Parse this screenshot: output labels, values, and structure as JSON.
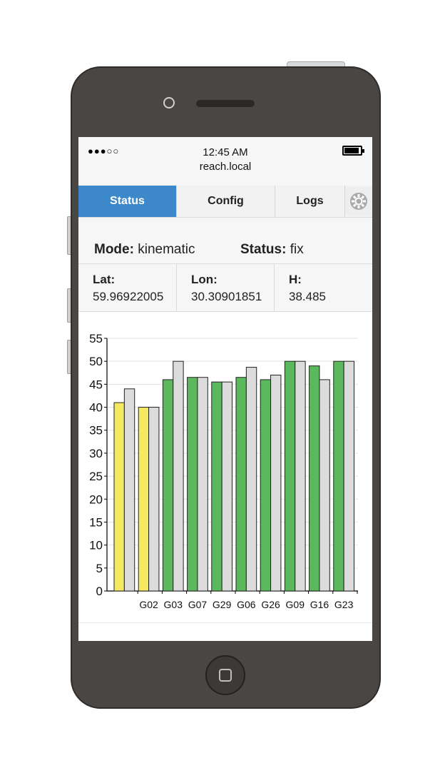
{
  "status_bar": {
    "signal_dots": "●●●○○",
    "time": "12:45 AM",
    "url": "reach.local"
  },
  "tabs": [
    {
      "label": "Status",
      "active": true
    },
    {
      "label": "Config",
      "active": false
    },
    {
      "label": "Logs",
      "active": false
    }
  ],
  "info": {
    "mode_label": "Mode:",
    "mode_value": "kinematic",
    "status_label": "Status:",
    "status_value": "fix",
    "lat_label": "Lat:",
    "lat_value": "59.96922005",
    "lon_label": "Lon:",
    "lon_value": "30.30901851",
    "h_label": "H:",
    "h_value": "38.485"
  },
  "colors": {
    "tab_active": "#3d88c9",
    "bar_green": "#5cb85c",
    "bar_yellow": "#f4e961",
    "bar_gray": "#dcdcdc"
  },
  "chart_data": {
    "type": "bar",
    "categories": [
      "",
      "G02",
      "G03",
      "G07",
      "G29",
      "G06",
      "G26",
      "G09",
      "G16",
      "G23"
    ],
    "series": [
      {
        "values": [
          41,
          40,
          46,
          46.5,
          45.5,
          46.5,
          46,
          50,
          49,
          50
        ],
        "colors": [
          "yellow",
          "yellow",
          "green",
          "green",
          "green",
          "green",
          "green",
          "green",
          "green",
          "green"
        ]
      },
      {
        "values": [
          44,
          40,
          50,
          46.5,
          45.5,
          48.7,
          47,
          50,
          46,
          50
        ],
        "colors": [
          "gray",
          "gray",
          "gray",
          "gray",
          "gray",
          "gray",
          "gray",
          "gray",
          "gray",
          "gray"
        ]
      }
    ],
    "ylim": [
      0,
      55
    ],
    "yticks": [
      0,
      5,
      10,
      15,
      20,
      25,
      30,
      35,
      40,
      45,
      50,
      55
    ],
    "grid": true
  }
}
